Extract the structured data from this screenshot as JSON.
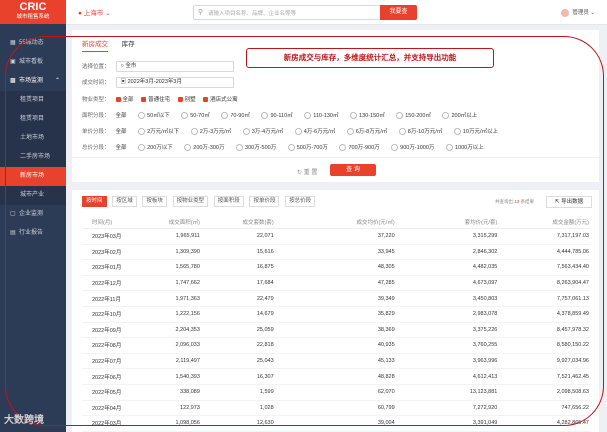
{
  "app": {
    "logo_title": "CRIC",
    "logo_subtitle": "城市租售系统"
  },
  "header": {
    "city": "上海市",
    "search_placeholder": "请输入项目名称、品牌、企业名等等",
    "search_button": "我要查",
    "user": "管理员"
  },
  "sidebar": {
    "items": [
      {
        "label": "55城动态",
        "icon": "grid-icon"
      },
      {
        "label": "城市看板",
        "icon": "monitor-icon"
      },
      {
        "label": "市场监测",
        "icon": "chart-icon"
      },
      {
        "label": "租赁项目"
      },
      {
        "label": "租赁项目"
      },
      {
        "label": "土地市场"
      },
      {
        "label": "二手房市场"
      },
      {
        "label": "新房市场"
      },
      {
        "label": "城市产业"
      },
      {
        "label": "企业监测",
        "icon": "building-icon"
      },
      {
        "label": "行业报告",
        "icon": "report-icon"
      }
    ]
  },
  "tabs": [
    "新房成交",
    "库存"
  ],
  "annotation": "新房成交与库存，多维度统计汇总，并支持导出功能",
  "filters": {
    "location_label": "选择位置：",
    "location_value": "全市",
    "time_label": "成交时间：",
    "time_value": "2022年3月-2023年3月",
    "property_label": "物业类型：",
    "property_options": [
      "全部",
      "普通住宅",
      "别墅",
      "酒店式公寓"
    ],
    "area_label": "面积分段：",
    "area_options": [
      "全部",
      "50㎡以下",
      "50-70㎡",
      "70-90㎡",
      "90-110㎡",
      "110-130㎡",
      "130-150㎡",
      "150-200㎡",
      "200㎡以上"
    ],
    "unit_label": "单价分段：",
    "unit_options": [
      "全部",
      "2万元/㎡以下",
      "2万-3万元/㎡",
      "3万-4万元/㎡",
      "4万-6万元/㎡",
      "6万-8万元/㎡",
      "8万-10万元/㎡",
      "10万元/㎡以上"
    ],
    "total_label": "总价分段：",
    "total_options": [
      "全部",
      "200万以下",
      "200万-300万",
      "300万-500万",
      "500万-700万",
      "700万-900万",
      "900万-1000万",
      "1000万以上"
    ],
    "reset": "重 置",
    "query": "查 询"
  },
  "groupby": [
    "按时间",
    "按区域",
    "按板块",
    "按物业类型",
    "按面积段",
    "按单价段",
    "按总价段"
  ],
  "result": {
    "prefix": "共查询出",
    "count": "13",
    "suffix": "条结果",
    "export": "导出数据"
  },
  "table": {
    "headers": [
      "时间(月)",
      "成交面积(㎡)",
      "成交套数(套)",
      "成交均价(元/㎡)",
      "套均价(元/套)",
      "成交金额(万元)"
    ],
    "rows": [
      [
        "2023年03月",
        "1,965,911",
        "22,071",
        "37,220",
        "3,315,299",
        "7,317,197.03"
      ],
      [
        "2023年02月",
        "1,309,390",
        "15,616",
        "33,945",
        "2,846,302",
        "4,444,785.06"
      ],
      [
        "2023年01月",
        "1,565,780",
        "16,875",
        "48,305",
        "4,482,035",
        "7,563,434.40"
      ],
      [
        "2022年12月",
        "1,747,662",
        "17,684",
        "47,285",
        "4,673,097",
        "8,263,904.47"
      ],
      [
        "2022年11月",
        "1,971,363",
        "22,479",
        "39,349",
        "3,450,803",
        "7,757,061.13"
      ],
      [
        "2022年10月",
        "1,222,156",
        "14,679",
        "35,829",
        "2,983,078",
        "4,378,859.49"
      ],
      [
        "2022年09月",
        "2,204,353",
        "25,059",
        "38,369",
        "3,375,226",
        "8,457,978.32"
      ],
      [
        "2022年08月",
        "2,096,033",
        "22,818",
        "40,935",
        "3,760,255",
        "8,580,150.22"
      ],
      [
        "2022年07月",
        "2,119,497",
        "25,043",
        "45,133",
        "3,963,996",
        "9,927,034.96"
      ],
      [
        "2022年06月",
        "1,540,393",
        "16,307",
        "48,828",
        "4,612,413",
        "7,521,462.45"
      ],
      [
        "2022年05月",
        "338,089",
        "1,599",
        "62,070",
        "13,123,881",
        "2,098,508.63"
      ],
      [
        "2022年04月",
        "122,973",
        "1,028",
        "60,799",
        "7,272,920",
        "747,656.22"
      ],
      [
        "2022年03月",
        "1,098,056",
        "12,630",
        "39,004",
        "3,391,049",
        "4,282,865.47"
      ]
    ]
  },
  "watermark": "大数跨境"
}
